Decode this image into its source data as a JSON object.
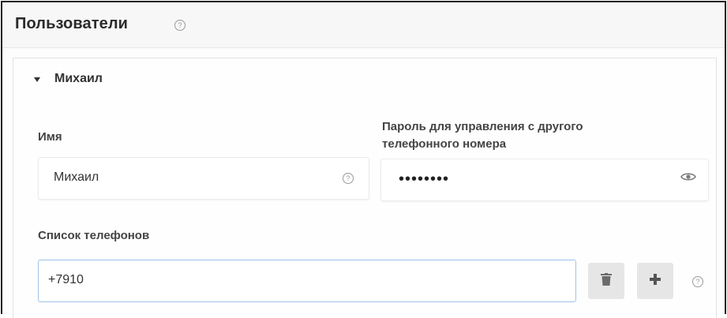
{
  "header": {
    "title": "Пользователи",
    "help_icon": "question-circle-icon"
  },
  "user": {
    "name": "Михаил",
    "expanded": true,
    "caret_icon": "caret-down-icon"
  },
  "form": {
    "name_label": "Имя",
    "name_value": "Михаил",
    "name_help_icon": "question-circle-icon",
    "password_label_line1": "Пароль для управления с другого",
    "password_label_line2": "телефонного номера",
    "password_masked": "••••••••",
    "password_toggle_icon": "eye-icon",
    "phones_label": "Список телефонов",
    "phone_value": "+7910",
    "delete_icon": "trash-icon",
    "add_icon": "plus-icon",
    "phones_help_icon": "question-circle-icon"
  },
  "colors": {
    "input_focus_border": "#9ec3e6",
    "button_bg": "#e6e6e6",
    "header_bg": "#f7f7f7"
  }
}
